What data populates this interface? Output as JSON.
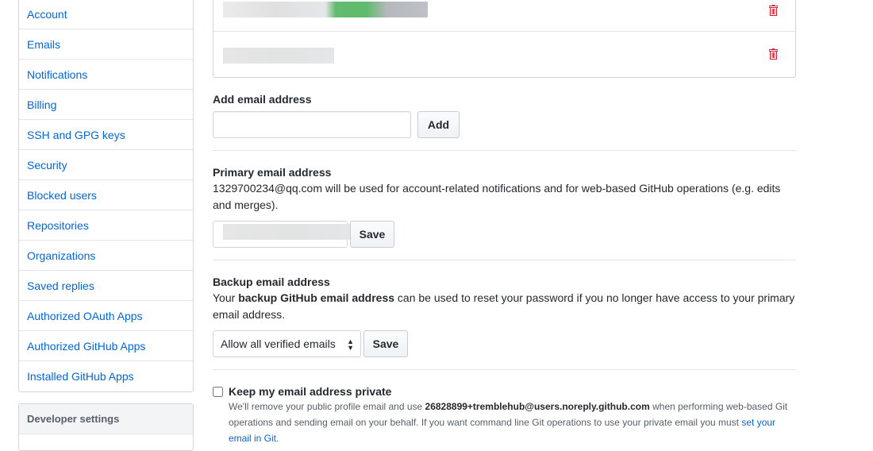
{
  "sidebar": {
    "items": [
      "Account",
      "Emails",
      "Notifications",
      "Billing",
      "SSH and GPG keys",
      "Security",
      "Blocked users",
      "Repositories",
      "Organizations",
      "Saved replies",
      "Authorized OAuth Apps",
      "Authorized GitHub Apps",
      "Installed GitHub Apps"
    ],
    "developer_settings": "Developer settings"
  },
  "emails": {
    "delete_icon": "trash-icon",
    "accent": "#cb2431"
  },
  "add": {
    "title": "Add email address",
    "input_value": "",
    "button": "Add"
  },
  "primary": {
    "title": "Primary email address",
    "desc": "1329700234@qq.com will be used for account-related notifications and for web-based GitHub operations (e.g. edits and merges).",
    "button": "Save"
  },
  "backup": {
    "title": "Backup email address",
    "desc_pre": "Your ",
    "desc_bold": "backup GitHub email address",
    "desc_post": " can be used to reset your password if you no longer have access to your primary email address.",
    "select_value": "Allow all verified emails",
    "button": "Save"
  },
  "private": {
    "label": "Keep my email address private",
    "checked": false,
    "note_pre": "We'll remove your public profile email and use ",
    "note_email": "26828899+tremblehub@users.noreply.github.com",
    "note_mid": " when performing web-based Git operations and sending email on your behalf. If you want command line Git operations to use your private email you must ",
    "note_link": "set your email in Git",
    "note_end": "."
  }
}
